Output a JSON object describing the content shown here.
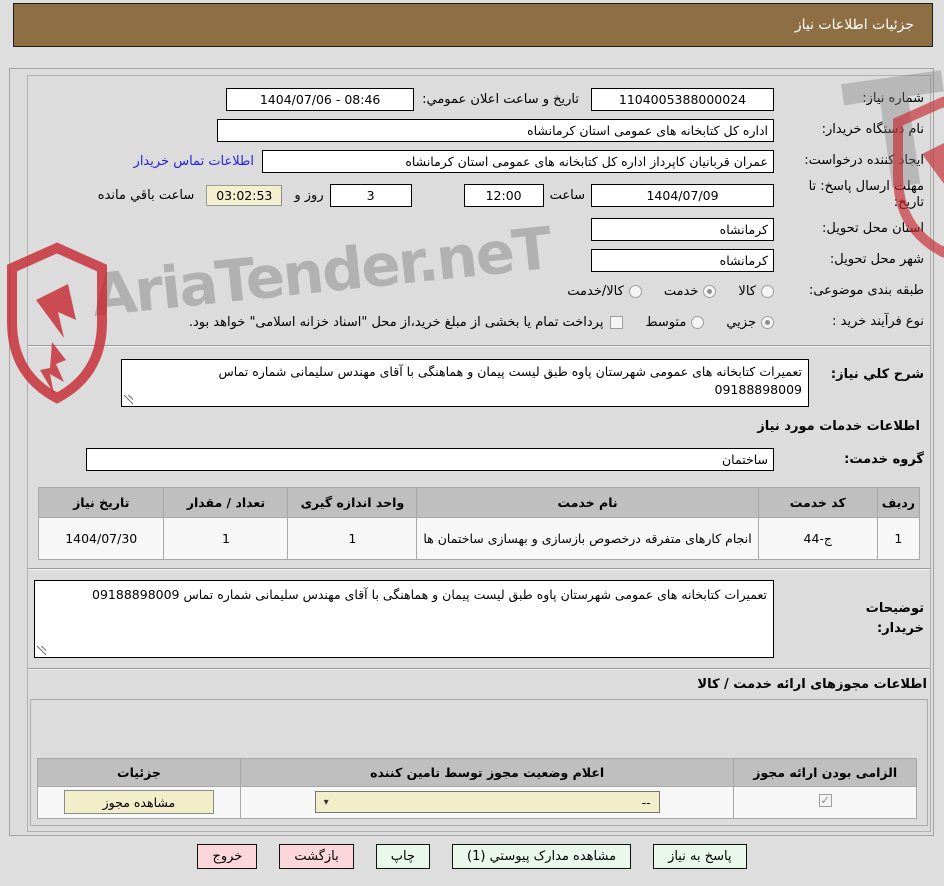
{
  "page_title": "جزئیات اطلاعات نیاز",
  "watermark": {
    "text": "AriaTender.neT",
    "t_fragment": "T"
  },
  "form": {
    "need_number": {
      "label": "شماره نیاز:",
      "value": "1104005388000024"
    },
    "announce": {
      "label": "تاریخ و ساعت اعلان عمومي:",
      "value": "1404/07/06 - 08:46"
    },
    "buyer_org": {
      "label": "نام دستگاه خریدار:",
      "value": "اداره کل کتابخانه های عمومی استان کرمانشاه"
    },
    "creator": {
      "label": "ایجاد کننده درخواست:",
      "value": "عمران قربانیان کاپرداز اداره کل کتابخانه های عمومی استان کرمانشاه",
      "contact_link": "اطلاعات تماس خریدار"
    },
    "deadline": {
      "label": "مهلت ارسال پاسخ: تا تاریخ:",
      "date": "1404/07/09",
      "time_label": "ساعت",
      "time": "12:00",
      "days": "3",
      "days_label": "روز و",
      "countdown": "03:02:53",
      "remaining_label": "ساعت باقي مانده"
    },
    "province": {
      "label": "استان محل تحویل:",
      "value": "کرمانشاه"
    },
    "city": {
      "label": "شهر محل تحویل:",
      "value": "کرمانشاه"
    },
    "category": {
      "label": "طبقه بندی موضوعی:",
      "options": [
        {
          "label": "کالا",
          "selected": false
        },
        {
          "label": "خدمت",
          "selected": true
        },
        {
          "label": "کالا/خدمت",
          "selected": false
        }
      ]
    },
    "process": {
      "label": "نوع فرآیند خرید :",
      "options": [
        {
          "label": "جزیي",
          "selected": true
        },
        {
          "label": "متوسط",
          "selected": false
        }
      ],
      "treasury_note": "پرداخت تمام یا بخشی از مبلغ خرید،از محل \"اسناد خزانه اسلامی\" خواهد بود.",
      "treasury_checked": false
    },
    "description": {
      "label": "شرح کلي نیاز:",
      "value": "تعمیرات کتابخانه های عمومی شهرستان پاوه  طبق لیست پیمان و هماهنگی با آقای مهندس سلیمانی شماره تماس 09188898009"
    }
  },
  "services_section": {
    "title": "اطلاعات خدمات مورد نیاز",
    "group": {
      "label": "گروه خدمت:",
      "value": "ساختمان"
    },
    "table": {
      "headers": [
        "ردیف",
        "کد خدمت",
        "نام خدمت",
        "واحد اندازه گیری",
        "تعداد / مقدار",
        "تاریخ نیاز"
      ],
      "rows": [
        [
          "1",
          "ج-44",
          "انجام کارهای متفرقه درخصوص بازسازی و بهسازی ساختمان ها",
          "1",
          "1",
          "1404/07/30"
        ]
      ]
    }
  },
  "buyer_notes": {
    "label_line1": "توضیحات",
    "label_line2": "خریدار:",
    "value": "تعمیرات کتابخانه های عمومی شهرستان پاوه  طبق لیست پیمان و هماهنگی با آقای مهندس سلیمانی شماره تماس 09188898009"
  },
  "permits_section": {
    "title": "اطلاعات مجوزهای ارائه خدمت / کالا",
    "table": {
      "headers": [
        "الزامی بودن ارائه مجوز",
        "اعلام وضعیت مجوز توسط تامین کننده",
        "جزئیات"
      ],
      "row": {
        "required_checked": true,
        "status_value": "--",
        "details_button": "مشاهده مجوز"
      }
    }
  },
  "footer": {
    "buttons": [
      {
        "label": "پاسخ به نیاز",
        "style": "green"
      },
      {
        "label": "مشاهده مدارک پیوستي (1)",
        "style": "green"
      },
      {
        "label": "چاپ",
        "style": "green"
      },
      {
        "label": "بازگشت",
        "style": "pink"
      },
      {
        "label": "خروج",
        "style": "pink"
      }
    ]
  },
  "colors": {
    "header_bg": "#8e6f44",
    "countdown_bg": "#f3efcf",
    "green_button": "#eaf8ec",
    "pink_button": "#fbd7dc",
    "cream_control": "#f1eec9",
    "link_blue": "#2424df",
    "table_header_bg": "#bfbfbf"
  }
}
